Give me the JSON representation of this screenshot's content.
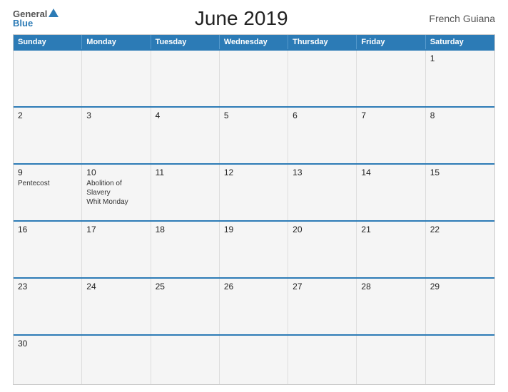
{
  "header": {
    "logo_general": "General",
    "logo_blue": "Blue",
    "title": "June 2019",
    "region": "French Guiana"
  },
  "days_of_week": [
    "Sunday",
    "Monday",
    "Tuesday",
    "Wednesday",
    "Thursday",
    "Friday",
    "Saturday"
  ],
  "weeks": [
    [
      {
        "day": "",
        "events": []
      },
      {
        "day": "",
        "events": []
      },
      {
        "day": "",
        "events": []
      },
      {
        "day": "",
        "events": []
      },
      {
        "day": "",
        "events": []
      },
      {
        "day": "",
        "events": []
      },
      {
        "day": "1",
        "events": []
      }
    ],
    [
      {
        "day": "2",
        "events": []
      },
      {
        "day": "3",
        "events": []
      },
      {
        "day": "4",
        "events": []
      },
      {
        "day": "5",
        "events": []
      },
      {
        "day": "6",
        "events": []
      },
      {
        "day": "7",
        "events": []
      },
      {
        "day": "8",
        "events": []
      }
    ],
    [
      {
        "day": "9",
        "events": [
          "Pentecost"
        ]
      },
      {
        "day": "10",
        "events": [
          "Abolition of Slavery",
          "Whit Monday"
        ]
      },
      {
        "day": "11",
        "events": []
      },
      {
        "day": "12",
        "events": []
      },
      {
        "day": "13",
        "events": []
      },
      {
        "day": "14",
        "events": []
      },
      {
        "day": "15",
        "events": []
      }
    ],
    [
      {
        "day": "16",
        "events": []
      },
      {
        "day": "17",
        "events": []
      },
      {
        "day": "18",
        "events": []
      },
      {
        "day": "19",
        "events": []
      },
      {
        "day": "20",
        "events": []
      },
      {
        "day": "21",
        "events": []
      },
      {
        "day": "22",
        "events": []
      }
    ],
    [
      {
        "day": "23",
        "events": []
      },
      {
        "day": "24",
        "events": []
      },
      {
        "day": "25",
        "events": []
      },
      {
        "day": "26",
        "events": []
      },
      {
        "day": "27",
        "events": []
      },
      {
        "day": "28",
        "events": []
      },
      {
        "day": "29",
        "events": []
      }
    ],
    [
      {
        "day": "30",
        "events": []
      },
      {
        "day": "",
        "events": []
      },
      {
        "day": "",
        "events": []
      },
      {
        "day": "",
        "events": []
      },
      {
        "day": "",
        "events": []
      },
      {
        "day": "",
        "events": []
      },
      {
        "day": "",
        "events": []
      }
    ]
  ]
}
